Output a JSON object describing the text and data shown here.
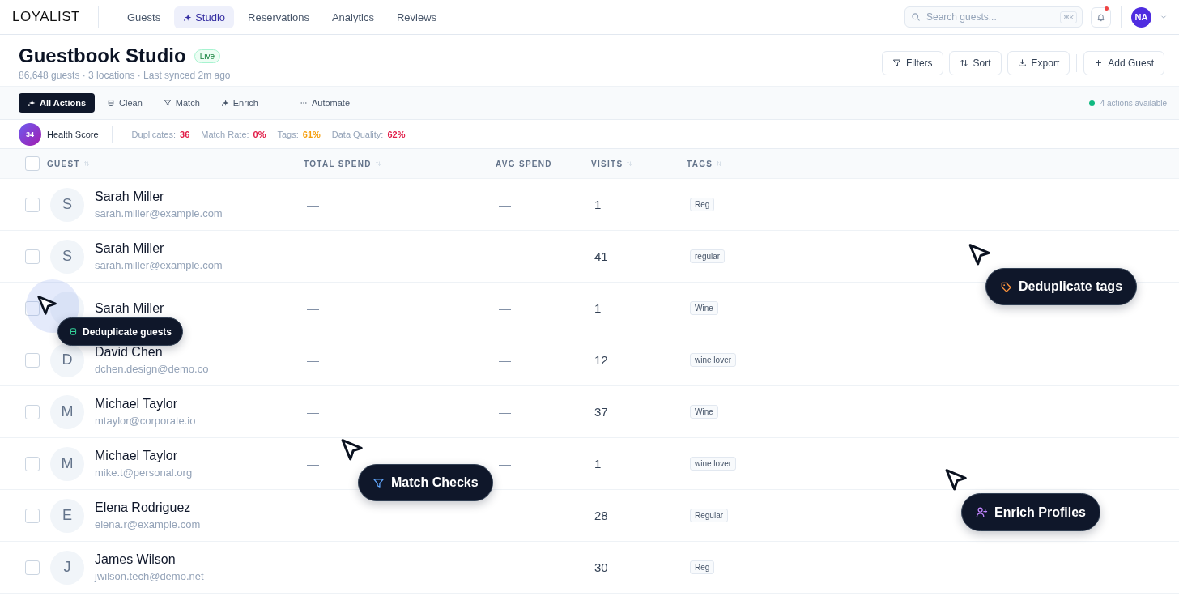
{
  "nav": {
    "logo": "LOYALIST",
    "tabs": [
      {
        "label": "Guests",
        "selected": false
      },
      {
        "label": "Studio",
        "selected": true
      },
      {
        "label": "Reservations",
        "selected": false
      },
      {
        "label": "Analytics",
        "selected": false
      },
      {
        "label": "Reviews",
        "selected": false
      }
    ],
    "search": {
      "placeholder": "Search guests...",
      "shortcut": "⌘K"
    },
    "notifications": {
      "unread": true
    },
    "avatar": "NA"
  },
  "header": {
    "title": "Guestbook Studio",
    "badge": "Live",
    "subtitle": "86,648 guests · 3 locations · Last synced 2m ago",
    "buttons": [
      "Filters",
      "Sort",
      "Export",
      "Add Guest"
    ]
  },
  "actions": {
    "items": [
      {
        "label": "All Actions",
        "selected": true
      },
      {
        "label": "Clean",
        "selected": false
      },
      {
        "label": "Match",
        "selected": false
      },
      {
        "label": "Enrich",
        "selected": false
      },
      {
        "label": "Automate",
        "selected": false
      }
    ],
    "available": "4 actions available"
  },
  "health": {
    "score": "34",
    "label": "Health Score",
    "metrics": [
      {
        "label": "Duplicates:",
        "value": "36",
        "color": "#e11d48"
      },
      {
        "label": "Match Rate:",
        "value": "0%",
        "color": "#e11d48"
      },
      {
        "label": "Tags:",
        "value": "61%",
        "color": "#f59e0b"
      },
      {
        "label": "Data Quality:",
        "value": "62%",
        "color": "#e11d48"
      }
    ]
  },
  "table": {
    "all_selected": false,
    "columns": [
      {
        "label": "GUEST",
        "sortable": true
      },
      {
        "label": "TOTAL SPEND",
        "sortable": true
      },
      {
        "label": "AVG SPEND",
        "sortable": false
      },
      {
        "label": "VISITS",
        "sortable": true
      },
      {
        "label": "TAGS",
        "sortable": true
      }
    ],
    "rows": [
      {
        "initial": "S",
        "name": "Sarah Miller",
        "email": "sarah.miller@example.com",
        "total_spend": "—",
        "avg_spend": "—",
        "visits": "1",
        "tag": "Reg",
        "checked": false
      },
      {
        "initial": "S",
        "name": "Sarah Miller",
        "email": "sarah.miller@example.com",
        "total_spend": "—",
        "avg_spend": "—",
        "visits": "41",
        "tag": "regular",
        "checked": false
      },
      {
        "name": "Sarah Miller",
        "total_spend": "—",
        "avg_spend": "—",
        "visits": "1",
        "tag": "Wine",
        "checked": false
      },
      {
        "initial": "D",
        "name": "David Chen",
        "email": "dchen.design@demo.co",
        "total_spend": "—",
        "avg_spend": "—",
        "visits": "12",
        "tag": "wine lover",
        "checked": false
      },
      {
        "initial": "M",
        "name": "Michael Taylor",
        "email": "mtaylor@corporate.io",
        "total_spend": "—",
        "avg_spend": "—",
        "visits": "37",
        "tag": "Wine",
        "checked": false
      },
      {
        "initial": "M",
        "name": "Michael Taylor",
        "email": "mike.t@personal.org",
        "total_spend": "—",
        "avg_spend": "—",
        "visits": "1",
        "tag": "wine lover",
        "checked": false
      },
      {
        "initial": "E",
        "name": "Elena Rodriguez",
        "email": "elena.r@example.com",
        "total_spend": "—",
        "avg_spend": "—",
        "visits": "28",
        "tag": "Regular",
        "checked": false
      },
      {
        "initial": "J",
        "name": "James Wilson",
        "email": "jwilson.tech@demo.net",
        "total_spend": "—",
        "avg_spend": "—",
        "visits": "30",
        "tag": "Reg",
        "checked": false
      }
    ]
  },
  "overlays": [
    "Deduplicate guests",
    "Deduplicate tags",
    "Match Checks",
    "Enrich Profiles"
  ]
}
